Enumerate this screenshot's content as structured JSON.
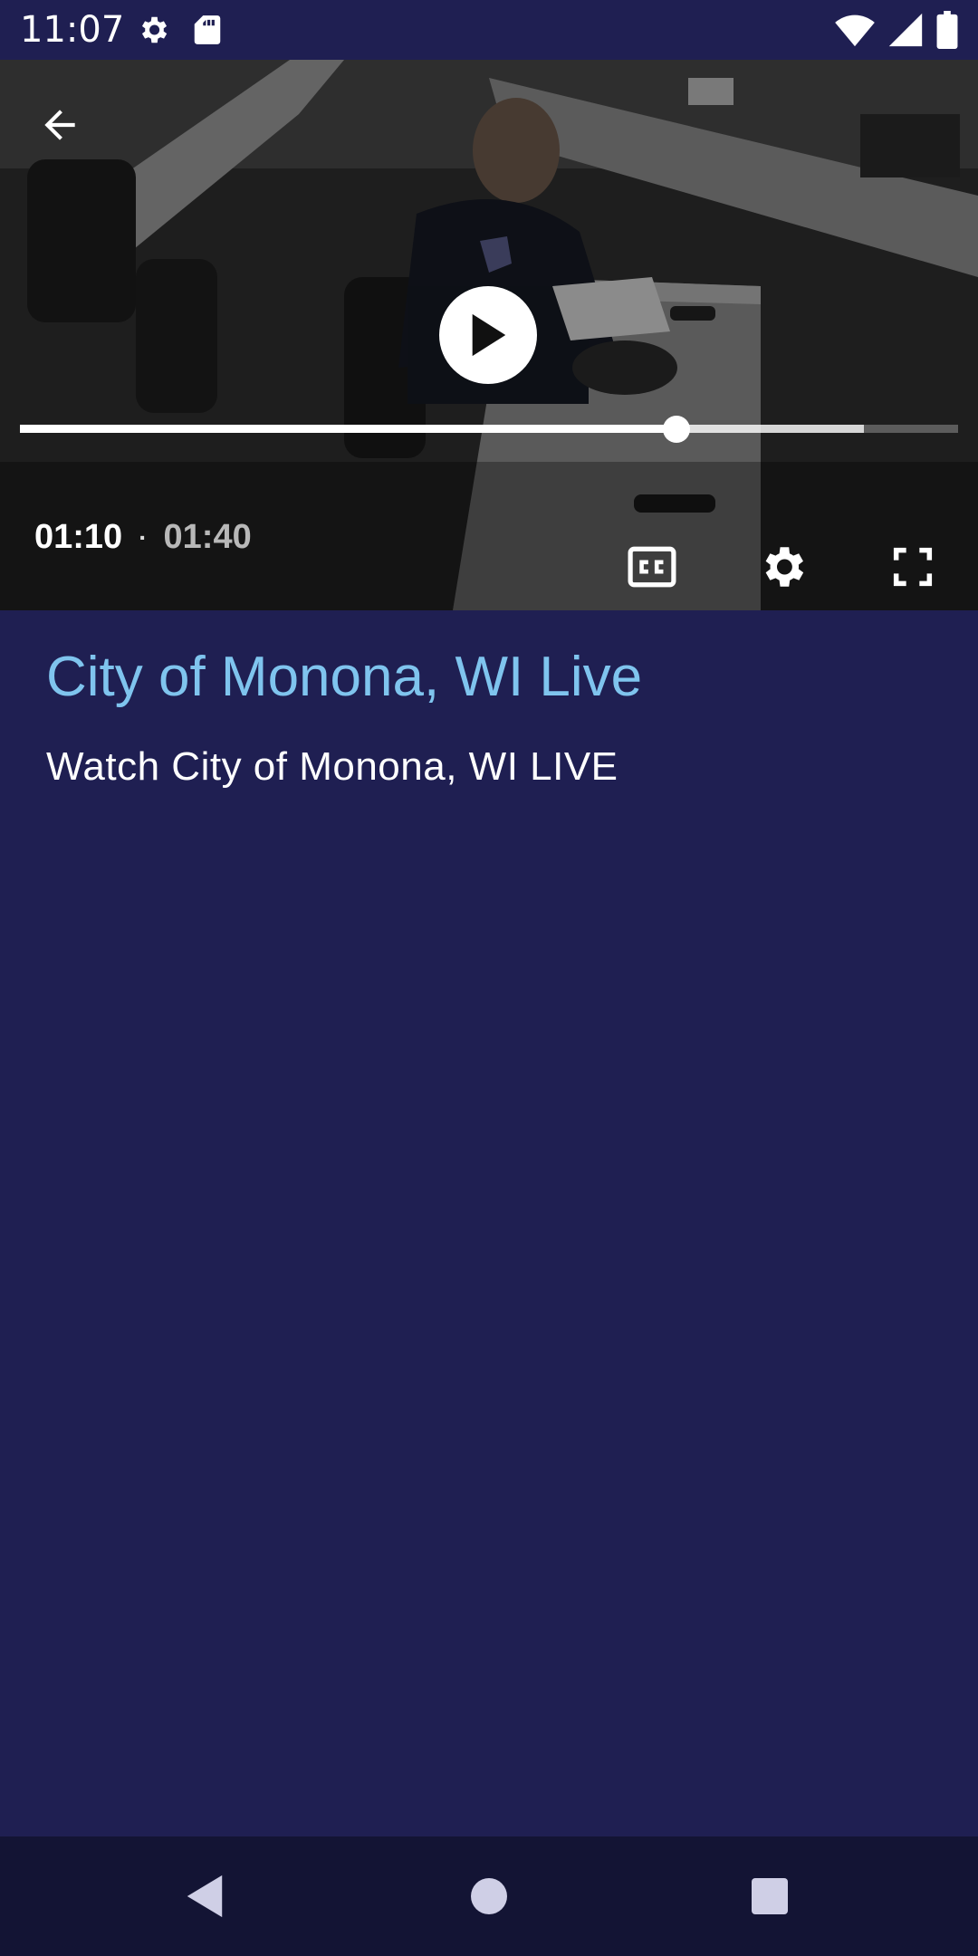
{
  "status_bar": {
    "time": "11:07",
    "icons": [
      "settings-icon",
      "sd-card-icon",
      "wifi-icon",
      "signal-icon",
      "battery-icon"
    ]
  },
  "player": {
    "current_time": "01:10",
    "separator": "·",
    "duration": "01:40",
    "progress_fraction": 0.7,
    "buffered_fraction": 0.9,
    "controls": [
      "back-arrow-icon",
      "play-icon",
      "closed-captions-icon",
      "settings-icon",
      "fullscreen-icon"
    ]
  },
  "content": {
    "title": "City of Monona, WI Live",
    "description": "Watch City of Monona, WI LIVE"
  },
  "colors": {
    "background": "#1f1f52",
    "title": "#7fc4ee",
    "nav_bar": "#131434"
  },
  "nav_bar": {
    "buttons": [
      "back-icon",
      "home-icon",
      "recents-icon"
    ]
  }
}
